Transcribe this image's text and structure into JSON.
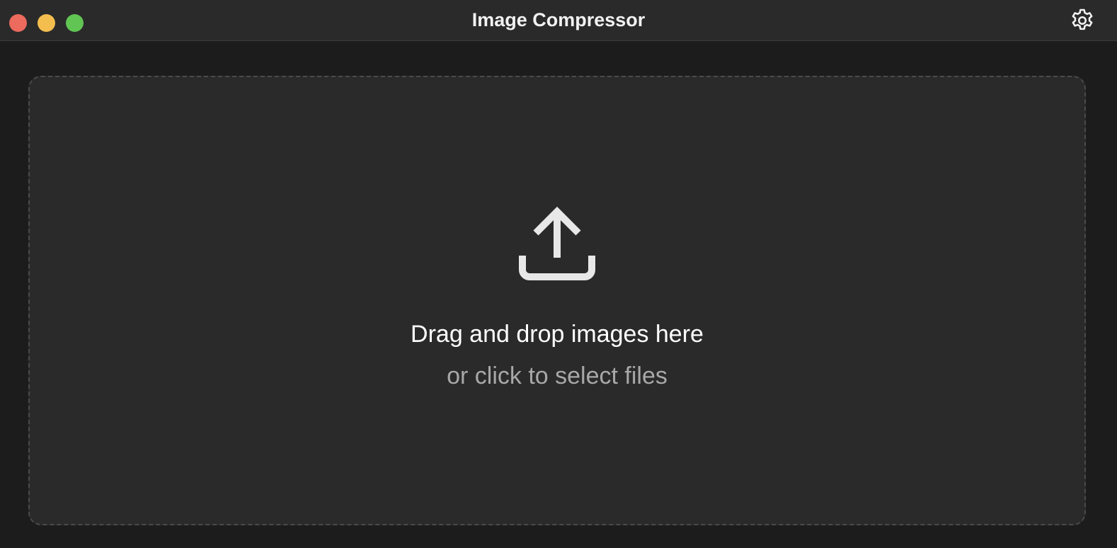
{
  "window": {
    "title": "Image Compressor",
    "controls": {
      "close_color": "#ec6a5e",
      "minimize_color": "#f4be4f",
      "zoom_color": "#61c554"
    },
    "settings_icon": "gear-icon"
  },
  "dropzone": {
    "icon": "upload-icon",
    "primary_text": "Drag and drop images here",
    "secondary_text": "or click to select files"
  }
}
